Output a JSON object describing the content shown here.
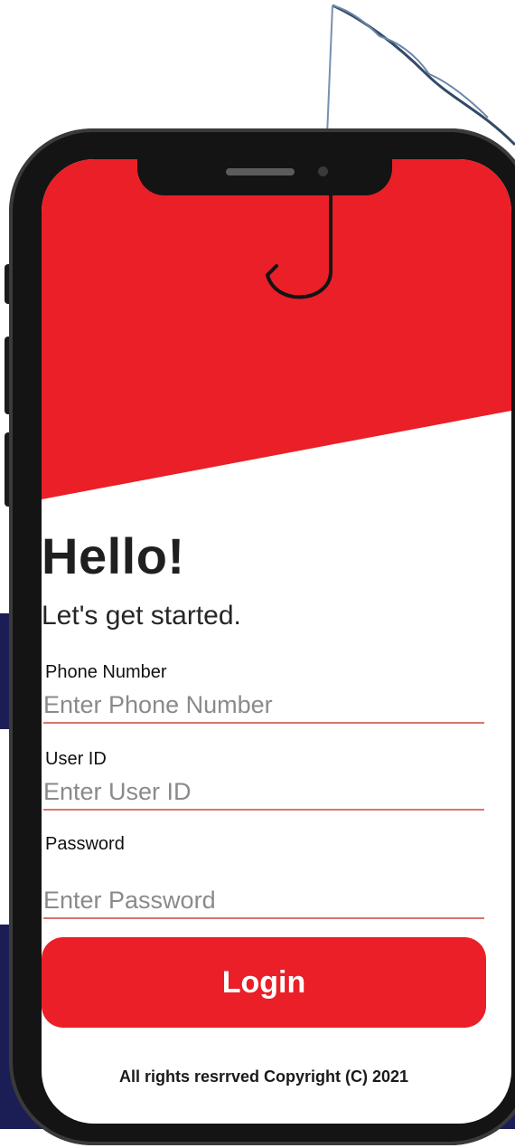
{
  "colors": {
    "brand_red": "#ea1f27",
    "navy": "#1b1e55",
    "input_underline": "#d9746f"
  },
  "icons": [
    "fishing-line-icon",
    "fishing-hook-icon"
  ],
  "header": {
    "title": "Hello!",
    "subtitle": "Let's get started."
  },
  "form": {
    "phone": {
      "label": "Phone Number",
      "placeholder": "Enter Phone Number"
    },
    "user_id": {
      "label": "User ID",
      "placeholder": "Enter User ID"
    },
    "password": {
      "label": "Password",
      "placeholder": "Enter Password"
    }
  },
  "login_button": {
    "label": "Login"
  },
  "footer": {
    "copyright": "All rights resrrved Copyright (C) 2021"
  }
}
